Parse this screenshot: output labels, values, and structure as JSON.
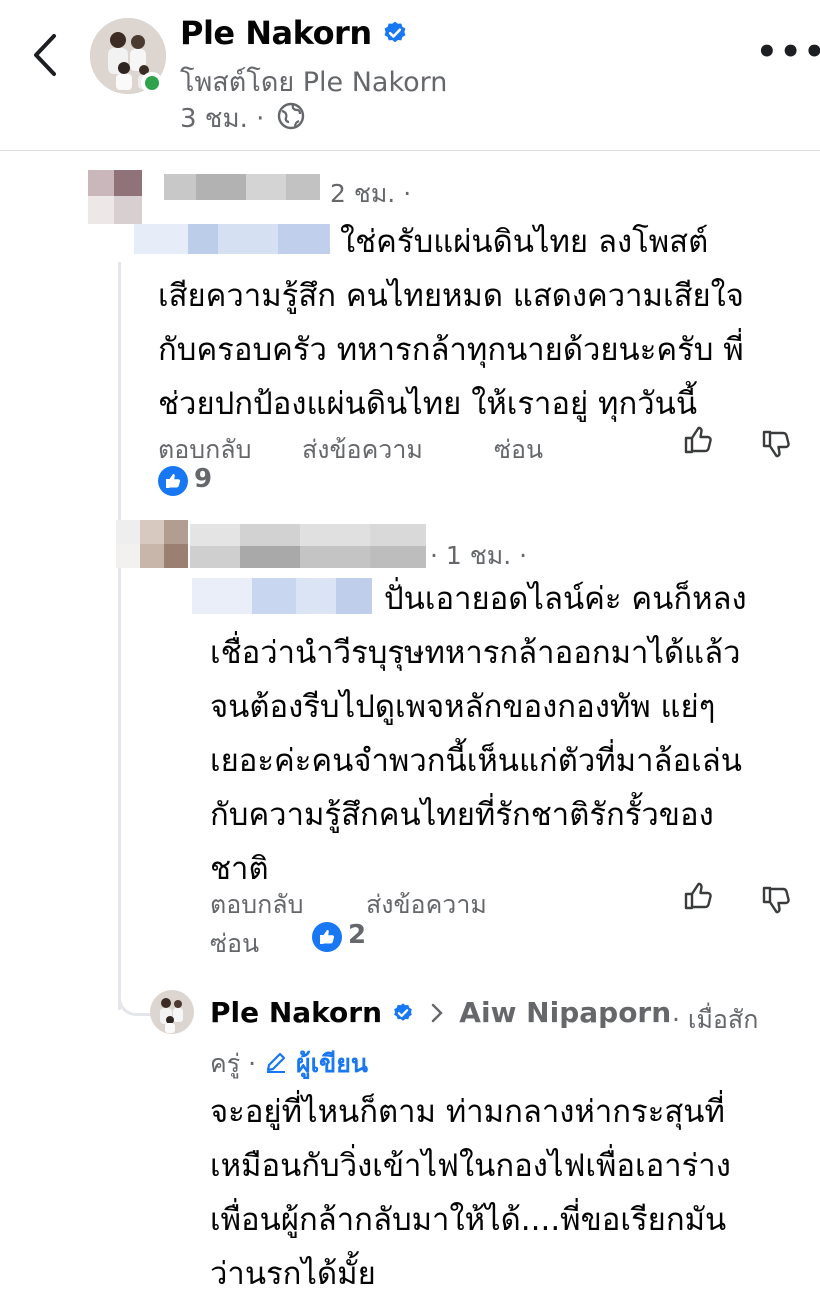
{
  "header": {
    "name": "Ple Nakorn",
    "subtitle": "โพสต์โดย Ple Nakorn",
    "time": "3 ชม. ·"
  },
  "comments": [
    {
      "time": "2 ชม. ·",
      "text": "ใช่ครับแผ่นดินไทย ลงโพสต์\nเสียความรู้สึก คนไทยหมด แสดงความเสียใจ\nกับครอบครัว ทหารกล้าทุกนายด้วยนะครับ พี่\nช่วยปกป้องแผ่นดินไทย ให้เราอยู่ ทุกวันนี้",
      "actions": [
        "ตอบกลับ",
        "ส่งข้อความ",
        "ซ่อน"
      ],
      "likes": "9"
    },
    {
      "time": "· 1 ชม. ·",
      "text": "ปั่นเอายอดไลน์ค่ะ คนก็หลง\nเชื่อว่านำวีรบุรุษทหารกล้าออกมาได้แล้ว\nจนต้องรีบไปดูเพจหลักของกองทัพ แย่ๆ\nเยอะค่ะคนจำพวกนี้เห็นแก่ตัวที่มาล้อเล่น\nกับความรู้สึกคนไทยที่รักชาติรักรั้วของ\nชาติ",
      "actions": [
        "ตอบกลับ",
        "ส่งข้อความ",
        "ซ่อน"
      ],
      "likes": "2"
    }
  ],
  "reply": {
    "name": "Ple Nakorn",
    "reply_to": "Aiw Nipaporn",
    "time_part1": "· เมื่อสัก",
    "time_part2": "ครู่ ·",
    "author_badge": "ผู้เขียน",
    "text": "จะอยู่ที่ไหนก็ตาม ท่ามกลางห่ากระสุนที่\nเหมือนกับวิ่งเข้าไฟในกองไฟเพื่อเอาร่าง\nเพื่อนผู้กล้ากลับมาให้ได้....พี่ขอเรียกมัน\nว่านรกได้มั้ย"
  },
  "colors": {
    "verified": "#1877f2",
    "online": "#31a24c",
    "secondary_text": "#65676b"
  },
  "icons": [
    "chevron-left-icon",
    "verified-badge-icon",
    "globe-icon",
    "more-horizontal-icon",
    "thumbs-up-icon",
    "thumbs-down-icon",
    "like-reaction-icon",
    "pencil-icon",
    "chevron-right-icon"
  ]
}
